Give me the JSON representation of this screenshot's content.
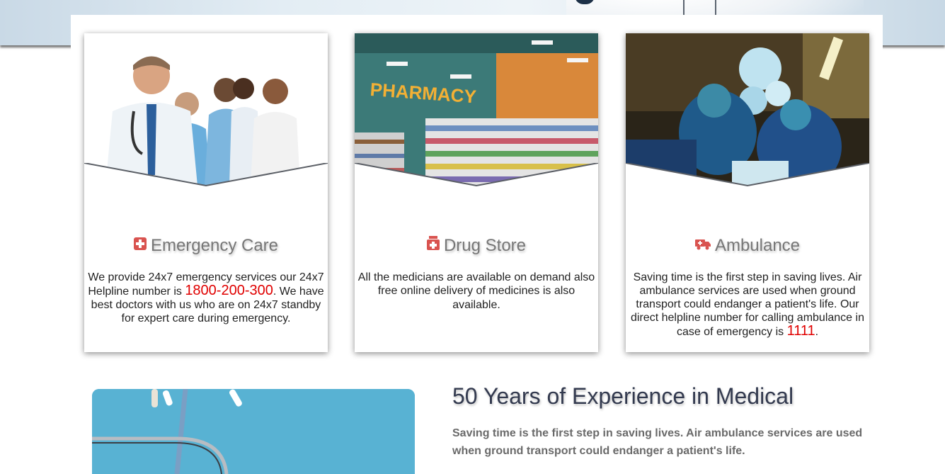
{
  "cards": [
    {
      "title": "Emergency Care",
      "icon": "medical-plus-icon",
      "text_before": "We provide 24x7 emergency services our 24x7 Helpline number is ",
      "highlight": "1800-200-300",
      "text_after": ". We have best doctors with us who are on 24x7 standby for expert care during emergency."
    },
    {
      "title": "Drug Store",
      "icon": "medicine-bottle-icon",
      "text_before": "All the medicians are available on demand also free online delivery of medicines is also available.",
      "highlight": "",
      "text_after": ""
    },
    {
      "title": "Ambulance",
      "icon": "ambulance-truck-icon",
      "text_before": "Saving time is the first step in saving lives. Air ambulance services are used when ground transport could endanger a patient's life. Our direct helpline number for calling ambulance in case of emergency is ",
      "highlight": "1111",
      "text_after": "."
    }
  ],
  "pharmacy_sign": "PHARMACY",
  "experience": {
    "title": "50 Years of Experience in Medical",
    "text": "Saving time is the first step in saving lives. Air ambulance services are used when ground transport could endanger a patient's life."
  },
  "colors": {
    "highlight": "#e00000",
    "icon": "#d9534f",
    "title": "#777777",
    "heading": "#333a4f"
  }
}
